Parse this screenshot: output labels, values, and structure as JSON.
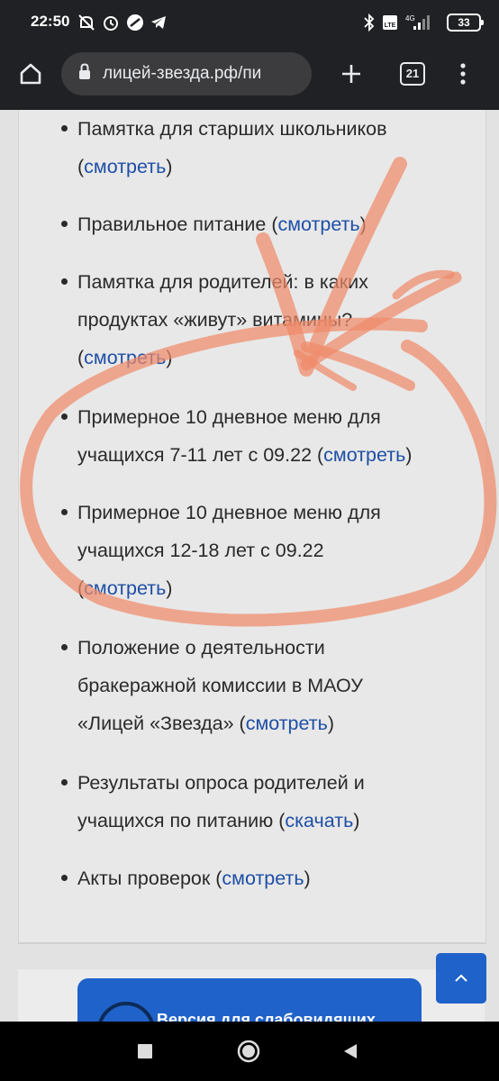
{
  "status_bar": {
    "time": "22:50",
    "battery": "33",
    "network": "4G",
    "volte": "LTE"
  },
  "browser": {
    "url": "лицей-звезда.рф/пи",
    "tab_count": "21"
  },
  "documents": [
    {
      "text": [
        "Памятка для старших школьников",
        "("
      ],
      "link": "смотреть",
      "after": ")"
    },
    {
      "text": [
        "Правильное питание ("
      ],
      "link": "смотреть",
      "after": ")"
    },
    {
      "text": [
        "Памятка для родителей: в каких",
        "продуктах «живут» витамины?",
        "("
      ],
      "link": "смотреть",
      "after": ")"
    },
    {
      "text": [
        "Примерное 10 дневное меню для",
        "учащихся 7-11 лет с 09.22 ("
      ],
      "link": "смотреть",
      "after": ")"
    },
    {
      "text": [
        "Примерное 10 дневное меню для",
        "учащихся 12-18 лет с 09.22",
        "("
      ],
      "link": "смотреть",
      "after": ")"
    },
    {
      "text": [
        "Положение о деятельности",
        "бракеражной комиссии в МАОУ",
        "«Лицей «Звезда» ("
      ],
      "link": "смотреть",
      "after": ")"
    },
    {
      "text": [
        "Результаты опроса родителей и",
        "учащихся по питанию ("
      ],
      "link": "скачать",
      "after": ")"
    },
    {
      "text": [
        "Акты проверок ("
      ],
      "link": "смотреть",
      "after": ")"
    }
  ],
  "vision_button": {
    "label": "Версия для слабовидящих"
  },
  "colors": {
    "link": "#1e4fa6",
    "accent": "#1f62c9",
    "annotation": "#f08a6a"
  }
}
